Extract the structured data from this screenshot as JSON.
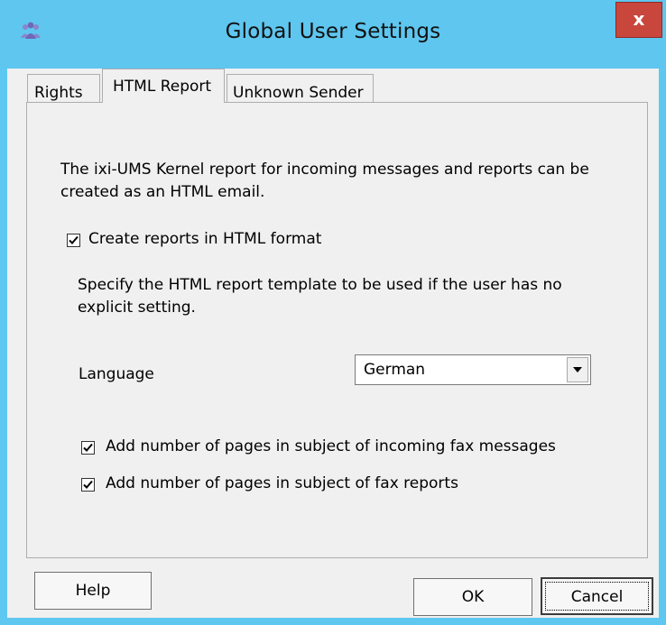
{
  "window": {
    "title": "Global User Settings",
    "close_label": "x",
    "icon": "users-icon"
  },
  "tabs": [
    {
      "label": "Rights",
      "active": false
    },
    {
      "label": "HTML Report",
      "active": true
    },
    {
      "label": "Unknown Sender",
      "active": false
    }
  ],
  "panel": {
    "description": "The ixi-UMS Kernel report for incoming messages and reports can be created as an HTML email.",
    "description_line1": "The ixi-UMS Kernel report for incoming messages and reports can be",
    "description_line2": "created as an HTML email.",
    "create_reports": {
      "label": "Create reports in HTML format",
      "checked": true
    },
    "template_hint_line1": "Specify the HTML report template to be used if the user has no",
    "template_hint_line2": "explicit setting.",
    "language": {
      "label": "Language",
      "value": "German",
      "icon": "chevron-down-icon"
    },
    "pages_incoming": {
      "label": "Add number of pages in subject of incoming fax messages",
      "checked": true
    },
    "pages_reports": {
      "label": "Add number of pages in subject of fax reports",
      "checked": true
    }
  },
  "buttons": {
    "help": "Help",
    "ok": "OK",
    "cancel": "Cancel"
  },
  "colors": {
    "titlebar": "#5ec6ef",
    "close": "#c9463d",
    "dialog": "#f0f0f0"
  }
}
